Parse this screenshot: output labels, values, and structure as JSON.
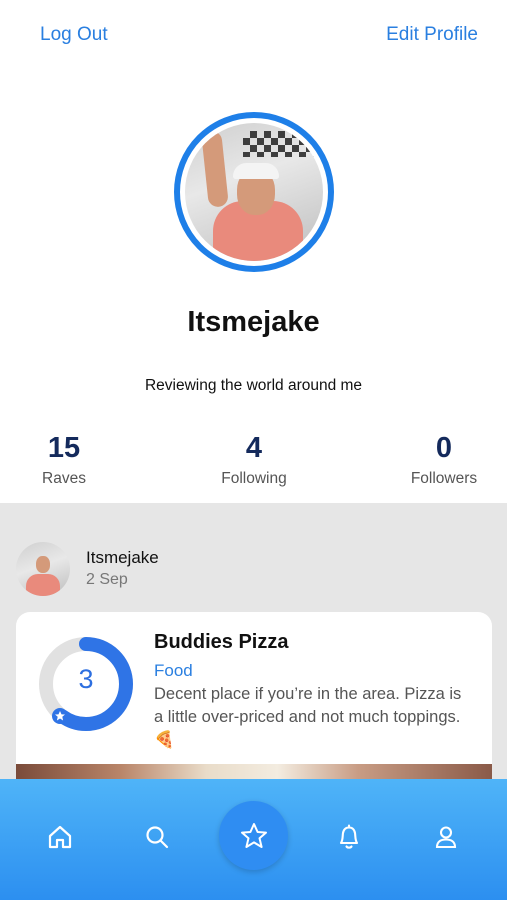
{
  "header": {
    "logout_label": "Log Out",
    "edit_label": "Edit Profile"
  },
  "profile": {
    "username": "Itsmejake",
    "bio": "Reviewing the world around me",
    "stats": [
      {
        "value": "15",
        "label": "Raves"
      },
      {
        "value": "4",
        "label": "Following"
      },
      {
        "value": "0",
        "label": "Followers"
      }
    ]
  },
  "post": {
    "user": "Itsmejake",
    "date": "2 Sep",
    "title": "Buddies Pizza",
    "category": "Food",
    "text": "Decent place if you’re in the area. Pizza is a little over-priced and not much toppings. 🍕",
    "rating": "3",
    "rating_fraction": 0.6
  },
  "tabs": [
    {
      "icon": "home-icon"
    },
    {
      "icon": "search-icon"
    },
    {
      "icon": "star-icon"
    },
    {
      "icon": "bell-icon"
    },
    {
      "icon": "profile-icon"
    }
  ],
  "colors": {
    "accent": "#1e7fe8",
    "link": "#2a7fe0",
    "stat_number": "#142a5c",
    "tabbar_top": "#4fb4f8",
    "tabbar_bottom": "#2c8ff0"
  }
}
